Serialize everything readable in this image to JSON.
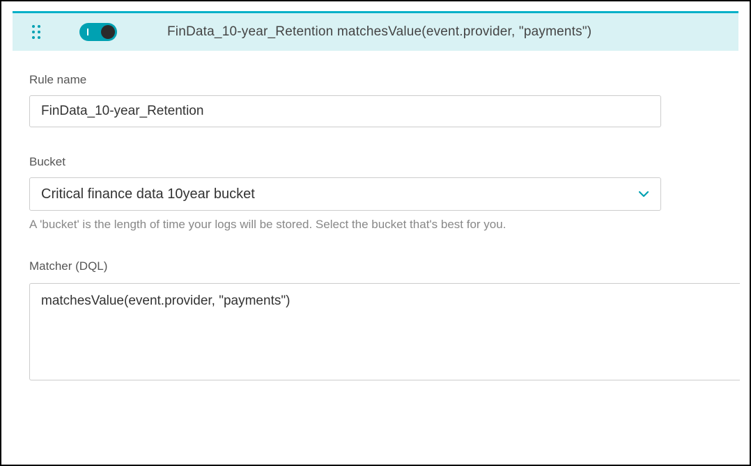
{
  "header": {
    "title": "FinData_10-year_Retention matchesValue(event.provider, \"payments\")"
  },
  "rule_name": {
    "label": "Rule name",
    "value": "FinData_10-year_Retention"
  },
  "bucket": {
    "label": "Bucket",
    "selected": "Critical finance data 10year bucket",
    "help": "A 'bucket' is the length of time your logs will be stored. Select the bucket that's best for you."
  },
  "matcher": {
    "label": "Matcher (DQL)",
    "value": "matchesValue(event.provider, \"payments\")"
  },
  "colors": {
    "accent": "#00a1b2"
  }
}
